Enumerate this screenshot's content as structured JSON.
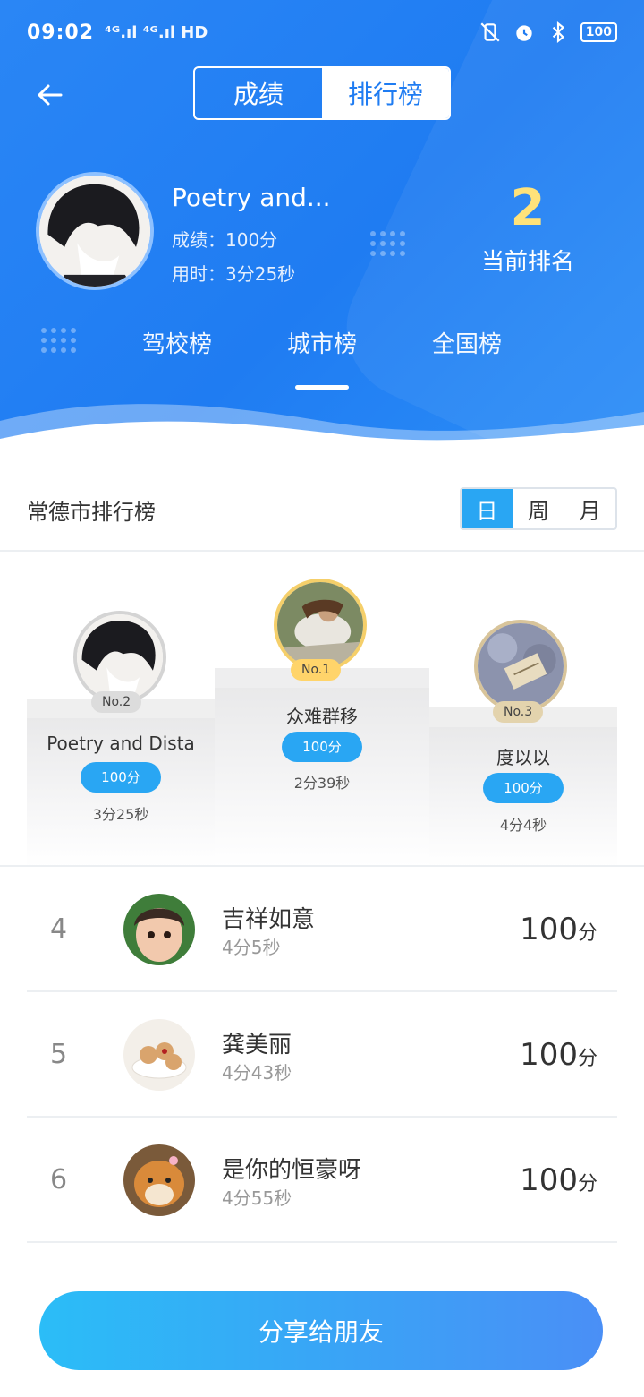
{
  "status_bar": {
    "time": "09:02",
    "network": "⁴ᴳ.ıl ⁴ᴳ.ıl HD",
    "battery": "100"
  },
  "header": {
    "segments": [
      {
        "label": "成绩",
        "active": false
      },
      {
        "label": "排行榜",
        "active": true
      }
    ],
    "me": {
      "name": "Poetry and...",
      "score": "成绩：100分",
      "time": "用时：3分25秒"
    },
    "rank": {
      "value": "2",
      "label": "当前排名"
    },
    "category_tabs": [
      {
        "label": "驾校榜",
        "active": false
      },
      {
        "label": "城市榜",
        "active": true
      },
      {
        "label": "全国榜",
        "active": false
      }
    ]
  },
  "ranking": {
    "title": "常德市排行榜",
    "periods": [
      {
        "label": "日",
        "active": true
      },
      {
        "label": "周",
        "active": false
      },
      {
        "label": "月",
        "active": false
      }
    ],
    "podium": {
      "first": {
        "badge": "No.1",
        "name": "众难群移",
        "score": "100分",
        "time": "2分39秒"
      },
      "second": {
        "badge": "No.2",
        "name": "Poetry and Dista",
        "score": "100分",
        "time": "3分25秒"
      },
      "third": {
        "badge": "No.3",
        "name": "度以以",
        "score": "100分",
        "time": "4分4秒"
      }
    },
    "list": [
      {
        "rank": "4",
        "name": "吉祥如意",
        "time": "4分5秒",
        "score": "100",
        "unit": "分"
      },
      {
        "rank": "5",
        "name": "龚美丽",
        "time": "4分43秒",
        "score": "100",
        "unit": "分"
      },
      {
        "rank": "6",
        "name": "是你的恒豪呀",
        "time": "4分55秒",
        "score": "100",
        "unit": "分"
      }
    ]
  },
  "share_button": {
    "label": "分享给朋友"
  },
  "colors": {
    "header_blue": "#1f7cf2",
    "accent_blue": "#29a6f3",
    "gold": "#ffe27a"
  }
}
